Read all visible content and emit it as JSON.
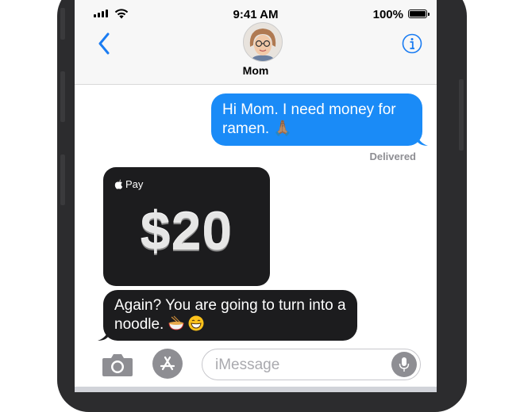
{
  "status_bar": {
    "time": "9:41 AM",
    "battery": "100%"
  },
  "header": {
    "contact_name": "Mom"
  },
  "messages": {
    "sent_text": "Hi Mom. I need money for ramen. 🙏🏽",
    "delivered_label": "Delivered",
    "pay_label": "Pay",
    "pay_amount": "$20",
    "received_text": "Again? You are going to turn into a noodle."
  },
  "input": {
    "placeholder": "iMessage"
  },
  "colors": {
    "sent_bubble": "#1a8bf7",
    "received_bubble": "#1c1c1e",
    "ios_blue": "#1a7cf2",
    "phone_frame": "#2c2c2e"
  },
  "icons": [
    "signal-icon",
    "wifi-icon",
    "battery-icon",
    "back-chevron-icon",
    "info-icon",
    "apple-logo-icon",
    "camera-icon",
    "app-store-icon",
    "microphone-icon",
    "ramen-emoji-icon",
    "grinning-emoji-icon",
    "praying-hands-emoji-icon"
  ]
}
